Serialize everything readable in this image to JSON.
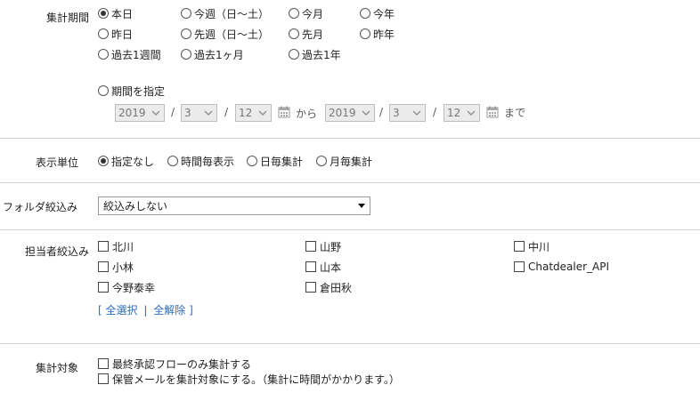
{
  "period": {
    "label": "集計期間",
    "options": {
      "today": "本日",
      "this_week": "今週（日〜土）",
      "this_month": "今月",
      "this_year": "今年",
      "yesterday": "昨日",
      "last_week": "先週（日〜土）",
      "last_month": "先月",
      "last_year": "昨年",
      "past_week": "過去1週間",
      "past_month": "過去1ヶ月",
      "past_year": "過去1年",
      "custom": "期間を指定"
    },
    "selected": "本日",
    "range": {
      "from_year": "2019",
      "from_month": "3",
      "from_day": "12",
      "to_year": "2019",
      "to_month": "3",
      "to_day": "12",
      "sep": "/",
      "from_text": "から",
      "to_text": "まで"
    }
  },
  "unit": {
    "label": "表示単位",
    "options": [
      "指定なし",
      "時間毎表示",
      "日毎集計",
      "月毎集計"
    ],
    "selected": "指定なし"
  },
  "folder": {
    "label": "フォルダ絞込み",
    "value": "絞込みしない"
  },
  "assignee": {
    "label": "担当者絞込み",
    "people": [
      "北川",
      "山野",
      "中川",
      "小林",
      "山本",
      "Chatdealer_API",
      "今野泰幸",
      "倉田秋"
    ],
    "select_all": "全選択",
    "deselect_all": "全解除",
    "bracket_open": "[",
    "bracket_close": "]",
    "separator": "|"
  },
  "target": {
    "label": "集計対象",
    "options": [
      "最終承認フローのみ集計する",
      "保管メールを集計対象にする。（集計に時間がかかります。）"
    ]
  },
  "colors": {
    "link": "#2a6ebb",
    "divider": "#cfcfcf",
    "disabled_bg": "#ebebeb"
  },
  "icons": {
    "calendar": "calendar-icon",
    "dropdown": "chevron-down-icon"
  }
}
